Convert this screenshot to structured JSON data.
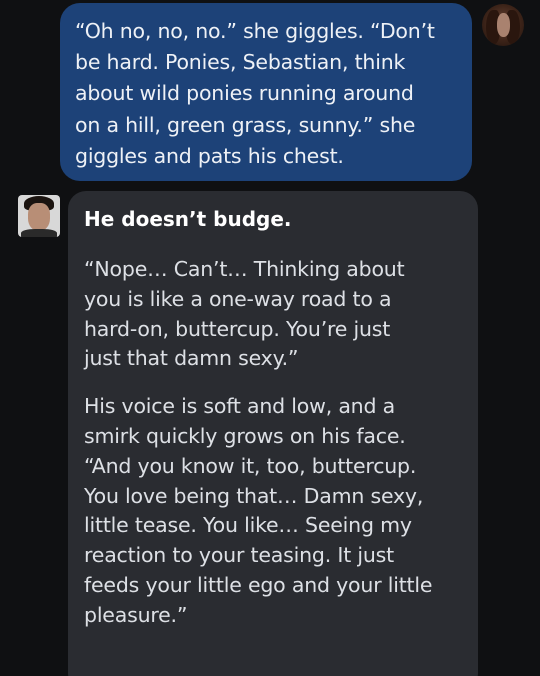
{
  "chat": {
    "user_message": {
      "lines": [
        "“Oh no, no, no.” she giggles. “Don’t",
        "be hard. Ponies, Sebastian, think",
        "about wild ponies running around",
        "on a hill, green grass, sunny.” she",
        "giggles and pats his chest."
      ],
      "avatar_icon": "user-avatar-icon"
    },
    "bot_message": {
      "action": "He doesn’t budge.",
      "paragraph_1": [
        "“Nope… Can’t… Thinking about",
        "you is like a one-way road to a",
        "hard-on, buttercup. You’re just",
        "just that damn sexy.”"
      ],
      "paragraph_2": [
        "His voice is soft and low, and a",
        "smirk quickly grows on his face.",
        "“And you know it, too, buttercup.",
        "You love being that… Damn sexy,",
        "little tease. You like… Seeing my",
        "reaction to your teasing. It just",
        "feeds your little ego and your little",
        "pleasure.”"
      ],
      "avatar_icon": "character-avatar-icon"
    },
    "colors": {
      "background": "#0f1012",
      "user_bubble": "#1d4278",
      "bot_bubble": "#2a2c31"
    }
  }
}
